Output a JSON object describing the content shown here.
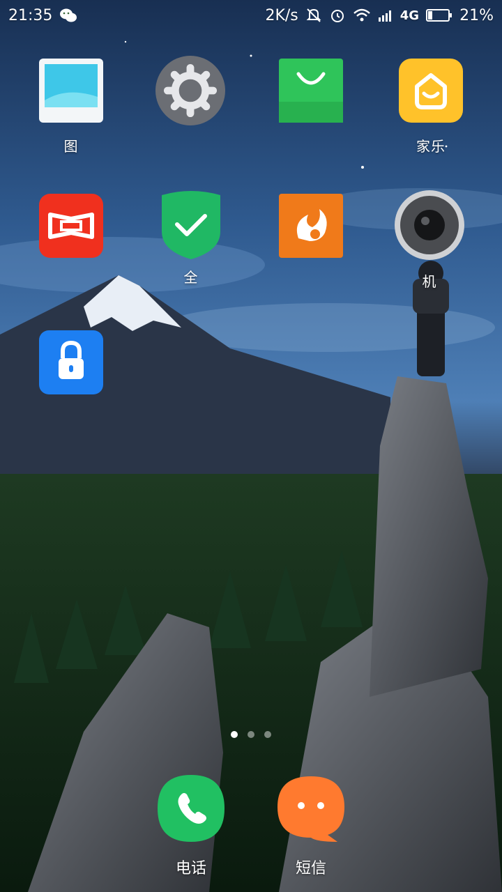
{
  "status_bar": {
    "time": "21:35",
    "notification_icon": "wechat-icon",
    "net_speed": "2K/s",
    "network": "4G",
    "battery_percent": "21%",
    "battery_level": 0.21,
    "icons": [
      "mute-icon",
      "alarm-icon",
      "wifi-icon",
      "signal-icon",
      "battery-icon"
    ]
  },
  "apps": [
    {
      "label": "图",
      "icon": "gallery-icon"
    },
    {
      "label": "",
      "icon": "settings-icon"
    },
    {
      "label": "",
      "icon": "app-store-icon"
    },
    {
      "label": "家乐",
      "icon": "home-icon"
    },
    {
      "label": "",
      "icon": "video-icon"
    },
    {
      "label": "全",
      "icon": "security-shield-icon"
    },
    {
      "label": "",
      "icon": "uc-browser-icon"
    },
    {
      "label": "机",
      "icon": "camera-icon"
    },
    {
      "label": "",
      "icon": "app-lock-icon"
    }
  ],
  "page_indicator": {
    "pages": 3,
    "current": 1
  },
  "dock": [
    {
      "label": "电话",
      "icon": "phone-icon",
      "color": "#21c062"
    },
    {
      "label": "短信",
      "icon": "message-icon",
      "color": "#ff7a2f"
    }
  ],
  "colors": {
    "sky_top": "#1b3a66",
    "sky_mid": "#3d6ea8",
    "forest": "#14301c",
    "rock": "#5b5f66"
  }
}
